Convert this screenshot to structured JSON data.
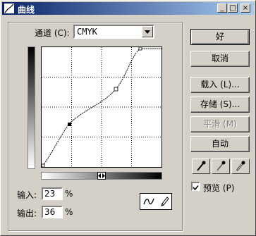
{
  "window": {
    "title": "曲线",
    "minimize_label": "_",
    "maximize_label": "□",
    "close_label": "×"
  },
  "channel": {
    "label": "通道 (C):",
    "value": "CMYK"
  },
  "fields": {
    "input_label": "输入:",
    "input_value": "23",
    "input_unit": "%",
    "output_label": "输出:",
    "output_value": "36",
    "output_unit": "%"
  },
  "buttons": {
    "ok": "好",
    "cancel": "取消",
    "load": "载入 (L)...",
    "save": "存储 (S)...",
    "smooth": "平滑 (M)",
    "auto": "自动"
  },
  "preview": {
    "label": "预览 (P)",
    "checked": true
  },
  "icons": {
    "curve_tool": "curve-icon",
    "pencil_tool": "pencil-icon",
    "black_eyedropper": "eyedropper-icon",
    "gray_eyedropper": "eyedropper-icon",
    "white_eyedropper": "eyedropper-icon"
  },
  "colors": {
    "titlebar_start": "#0a246a",
    "titlebar_end": "#a6caf0",
    "face": "#d4d0c8"
  }
}
